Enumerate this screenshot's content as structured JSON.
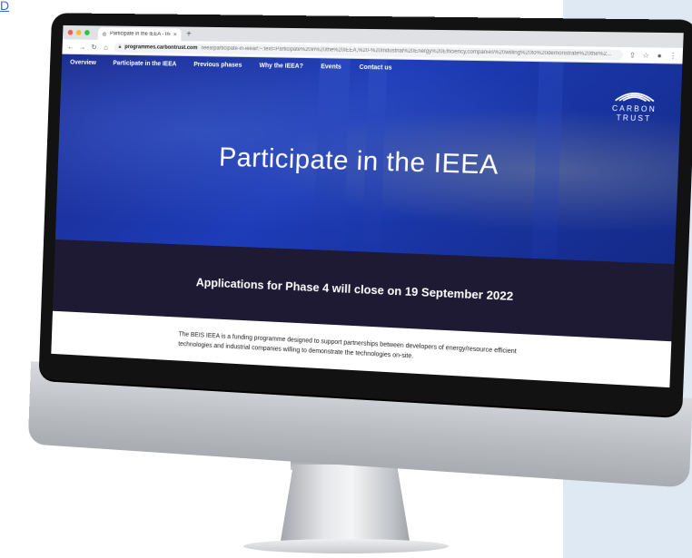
{
  "corner_link": "D",
  "browser": {
    "tab_title": "Participate in the IEEA - Indust",
    "url_domain": "programmes.carbontrust.com",
    "url_path": "/ieea/participate-in-ieea#:~:text=Participate%20in%20the%20IEEA,%20-%20Industrial%20Energy%20Efficiency,companies%20willing%20to%20demonstrate%20the%2..."
  },
  "nav": {
    "items": [
      "Overview",
      "Participate in the IEEA",
      "Previous phases",
      "Why the IEEA?",
      "Events",
      "Contact us"
    ]
  },
  "logo": {
    "line1": "CARBON",
    "line2": "TRUST"
  },
  "hero": {
    "title": "Participate in the IEEA"
  },
  "banner": {
    "text": "Applications for Phase 4 will close on 19 September 2022"
  },
  "intro": {
    "text": "The BEIS IEEA is a funding programme designed to support partnerships between developers of energy/resource efficient technologies and industrial companies willing to demonstrate the technologies on-site."
  },
  "colors": {
    "hero_blue": "#1d3cb8",
    "banner_dark": "#1e1a33",
    "side_panel": "#dfe9f4"
  }
}
